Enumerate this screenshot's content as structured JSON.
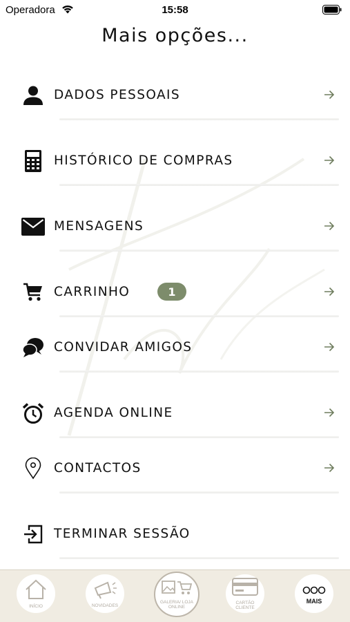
{
  "status_bar": {
    "carrier": "Operadora",
    "time": "15:58"
  },
  "page": {
    "title": "Mais opções..."
  },
  "menu": [
    {
      "label": "DADOS PESSOAIS",
      "icon": "person-icon"
    },
    {
      "label": "HISTÓRICO DE COMPRAS",
      "icon": "calculator-icon"
    },
    {
      "label": "MENSAGENS",
      "icon": "envelope-icon"
    },
    {
      "label": "CARRINHO",
      "icon": "cart-icon",
      "badge": "1"
    },
    {
      "label": "CONVIDAR AMIGOS",
      "icon": "chat-bubbles-icon"
    },
    {
      "label": "AGENDA ONLINE",
      "icon": "alarm-clock-icon"
    },
    {
      "label": "CONTACTOS",
      "icon": "location-pin-icon"
    },
    {
      "label": "TERMINAR SESSÃO",
      "icon": "logout-icon"
    }
  ],
  "tab_bar": {
    "tabs": [
      {
        "label": "INÍCIO",
        "icon": "home-icon"
      },
      {
        "label": "NOVIDADES",
        "icon": "megaphone-icon"
      },
      {
        "label": "GALERIA/ LOJA ONLINE",
        "icon": "gallery-cart-icon"
      },
      {
        "label": "CARTÃO CLIENTE",
        "icon": "card-icon"
      },
      {
        "label": "MAIS",
        "icon": "more-dots-icon",
        "active": true
      }
    ]
  },
  "colors": {
    "accent": "#7d8c6b",
    "tab_bar_bg": "#f0ece2",
    "arrow": "#6f7d5e"
  }
}
